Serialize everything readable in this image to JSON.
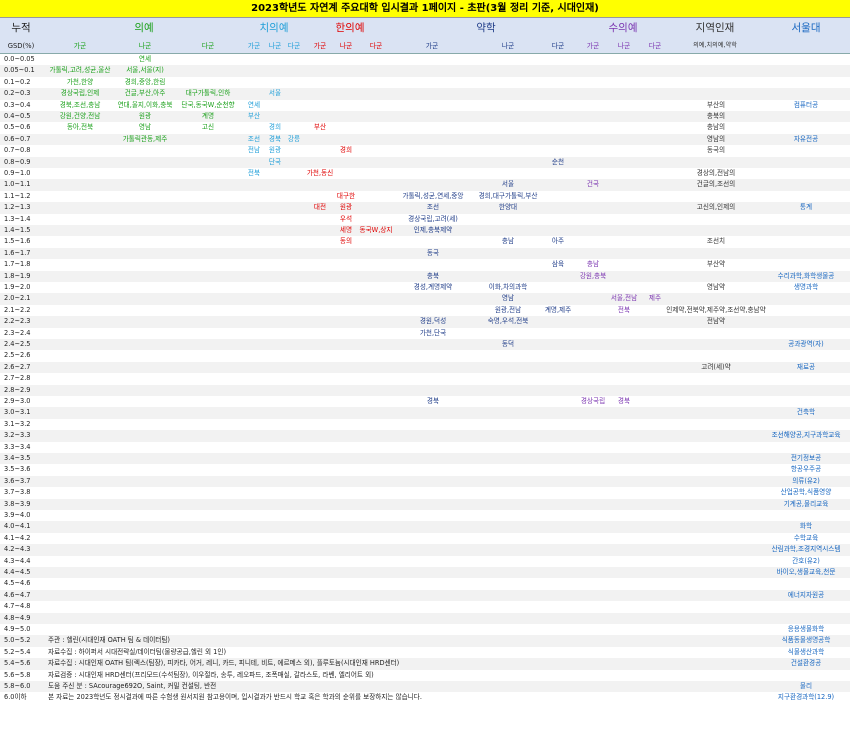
{
  "title": "2023학년도 자연계 주요대학 입시결과 1페이지 - 초판(3월 정리 기준, 시대인재)",
  "header": {
    "cumulative": "누적",
    "gsd": "GSD(%)",
    "groups": [
      {
        "label": "의예",
        "color": "#1aa01a"
      },
      {
        "label": "치의예",
        "color": "#1e9ed8"
      },
      {
        "label": "한의예",
        "color": "#e00000"
      },
      {
        "label": "약학",
        "color": "#1f3c88"
      },
      {
        "label": "수의예",
        "color": "#7a33b0"
      },
      {
        "label": "지역인재",
        "color": "#333333"
      },
      {
        "label": "서울대",
        "color": "#1565c0"
      }
    ],
    "subs": [
      "가군",
      "나군",
      "다군",
      "가군",
      "나군",
      "다군",
      "가군",
      "나군",
      "다군",
      "가군",
      "나군",
      "다군",
      "가군",
      "나군",
      "다군",
      "의예,치의예,약학",
      ""
    ]
  },
  "rows": [
    {
      "label": "0.0~0.05",
      "cells": [
        [
          "c1",
          "연세"
        ]
      ]
    },
    {
      "label": "0.05~0.1",
      "cells": [
        [
          "c0",
          "가톨릭,고려,성균,울산"
        ],
        [
          "c1",
          "서울,서울(지)"
        ]
      ]
    },
    {
      "label": "0.1~0.2",
      "cells": [
        [
          "c0",
          "가천,한양"
        ],
        [
          "c1",
          "경희,중앙,한림"
        ]
      ]
    },
    {
      "label": "0.2~0.3",
      "cells": [
        [
          "c0",
          "경상국립,인제"
        ],
        [
          "c1",
          "건글,부산,아주"
        ],
        [
          "c2",
          "대구가톨릭,인하"
        ],
        [
          "c4",
          "서울"
        ]
      ]
    },
    {
      "label": "0.3~0.4",
      "cells": [
        [
          "c0",
          "경북,조선,충남"
        ],
        [
          "c1",
          "연대,울지,이화,충북"
        ],
        [
          "c2",
          "단국,동국W,순천향"
        ],
        [
          "c3",
          "연세"
        ],
        [
          "c15",
          "부산의"
        ],
        [
          "c16",
          "컴퓨터공"
        ]
      ]
    },
    {
      "label": "0.4~0.5",
      "cells": [
        [
          "c0",
          "강원,건양,전남"
        ],
        [
          "c1",
          "원광"
        ],
        [
          "c2",
          "계명"
        ],
        [
          "c3",
          "부산"
        ],
        [
          "c15",
          "충북의"
        ]
      ]
    },
    {
      "label": "0.5~0.6",
      "cells": [
        [
          "c0",
          "동아,전북"
        ],
        [
          "c1",
          "영남"
        ],
        [
          "c2",
          "고신"
        ],
        [
          "c4",
          "경희"
        ],
        [
          "c6",
          "부산"
        ],
        [
          "c15",
          "충남의"
        ]
      ]
    },
    {
      "label": "0.6~0.7",
      "cells": [
        [
          "c1",
          "가톨릭관동,제주"
        ],
        [
          "c3",
          "조선"
        ],
        [
          "c4",
          "경북"
        ],
        [
          "c5",
          "강릉"
        ],
        [
          "c15",
          "영남의"
        ],
        [
          "c16",
          "자유전공"
        ]
      ]
    },
    {
      "label": "0.7~0.8",
      "cells": [
        [
          "c3",
          "전남"
        ],
        [
          "c4",
          "원광"
        ],
        [
          "c7",
          "경희"
        ],
        [
          "c15",
          "동국의"
        ]
      ]
    },
    {
      "label": "0.8~0.9",
      "cells": [
        [
          "c4",
          "단국"
        ],
        [
          "c11",
          "순천"
        ]
      ]
    },
    {
      "label": "0.9~1.0",
      "cells": [
        [
          "c3",
          "전북"
        ],
        [
          "c6",
          "가천,동신"
        ],
        [
          "c15",
          "경상의,전남의"
        ]
      ]
    },
    {
      "label": "1.0~1.1",
      "cells": [
        [
          "c10",
          "서울"
        ],
        [
          "c12",
          "건국"
        ],
        [
          "c15",
          "건글의,조선의"
        ]
      ]
    },
    {
      "label": "1.1~1.2",
      "cells": [
        [
          "c7",
          "대구한"
        ],
        [
          "c9",
          "가톨릭,성균,연세,중앙"
        ],
        [
          "c10",
          "경희,대구가톨릭,부산"
        ]
      ]
    },
    {
      "label": "1.2~1.3",
      "cells": [
        [
          "c6",
          "대전"
        ],
        [
          "c7",
          "원광"
        ],
        [
          "c9",
          "조선"
        ],
        [
          "c10",
          "한양대"
        ],
        [
          "c15",
          "고신의,인제의"
        ],
        [
          "c16",
          "통계"
        ]
      ]
    },
    {
      "label": "1.3~1.4",
      "cells": [
        [
          "c7",
          "우석"
        ],
        [
          "c9",
          "경상국립,고려(세)"
        ]
      ]
    },
    {
      "label": "1.4~1.5",
      "cells": [
        [
          "c7",
          "세명"
        ],
        [
          "c8",
          "동국W,상지"
        ],
        [
          "c9",
          "인제,충북제약"
        ]
      ]
    },
    {
      "label": "1.5~1.6",
      "cells": [
        [
          "c7",
          "동의"
        ],
        [
          "c10",
          "충남"
        ],
        [
          "c11",
          "아주"
        ],
        [
          "c15",
          "조선치"
        ]
      ]
    },
    {
      "label": "1.6~1.7",
      "cells": [
        [
          "c9",
          "동국"
        ]
      ]
    },
    {
      "label": "1.7~1.8",
      "cells": [
        [
          "c11",
          "삼육"
        ],
        [
          "c12",
          "충남"
        ],
        [
          "c15",
          "부산약"
        ]
      ]
    },
    {
      "label": "1.8~1.9",
      "cells": [
        [
          "c9",
          "충북"
        ],
        [
          "c12",
          "강원,충북"
        ],
        [
          "c16",
          "수리과학,화학생물공"
        ]
      ]
    },
    {
      "label": "1.9~2.0",
      "cells": [
        [
          "c9",
          "경성,계명제약"
        ],
        [
          "c10",
          "이화,차의과학"
        ],
        [
          "c15",
          "영남약"
        ],
        [
          "c16",
          "생명과학"
        ]
      ]
    },
    {
      "label": "2.0~2.1",
      "cells": [
        [
          "c10",
          "영남"
        ],
        [
          "c13",
          "서울,전남"
        ],
        [
          "c14",
          "제주"
        ]
      ]
    },
    {
      "label": "2.1~2.2",
      "cells": [
        [
          "c10",
          "원광,전남"
        ],
        [
          "c11",
          "계명,제주"
        ],
        [
          "c13",
          "전북"
        ],
        [
          "c15",
          "인제약,전북약,제주약,조선약,충남약"
        ]
      ]
    },
    {
      "label": "2.2~2.3",
      "cells": [
        [
          "c9",
          "경원,덕성"
        ],
        [
          "c10",
          "숙명,우석,전북"
        ],
        [
          "c15",
          "전남약"
        ]
      ]
    },
    {
      "label": "2.3~2.4",
      "cells": [
        [
          "c9",
          "가천,단국"
        ]
      ]
    },
    {
      "label": "2.4~2.5",
      "cells": [
        [
          "c10",
          "동덕"
        ],
        [
          "c16",
          "공과광역(자)"
        ]
      ]
    },
    {
      "label": "2.5~2.6",
      "cells": []
    },
    {
      "label": "2.6~2.7",
      "cells": [
        [
          "c15",
          "고려(세)약"
        ],
        [
          "c16",
          "재료공"
        ]
      ]
    },
    {
      "label": "2.7~2.8",
      "cells": []
    },
    {
      "label": "2.8~2.9",
      "cells": []
    },
    {
      "label": "2.9~3.0",
      "cells": [
        [
          "c9",
          "경북"
        ],
        [
          "c12",
          "경상국립"
        ],
        [
          "c13",
          "경북"
        ]
      ]
    },
    {
      "label": "3.0~3.1",
      "cells": [
        [
          "c16",
          "건축학"
        ]
      ]
    },
    {
      "label": "3.1~3.2",
      "cells": []
    },
    {
      "label": "3.2~3.3",
      "cells": [
        [
          "c16",
          "조선해양공,지구과학교육"
        ]
      ]
    },
    {
      "label": "3.3~3.4",
      "cells": []
    },
    {
      "label": "3.4~3.5",
      "cells": [
        [
          "c16",
          "전기정보공"
        ]
      ]
    },
    {
      "label": "3.5~3.6",
      "cells": [
        [
          "c16",
          "항공우주공"
        ]
      ]
    },
    {
      "label": "3.6~3.7",
      "cells": [
        [
          "c16",
          "의류(유2)"
        ]
      ]
    },
    {
      "label": "3.7~3.8",
      "cells": [
        [
          "c16",
          "산업공학,식품영양"
        ]
      ]
    },
    {
      "label": "3.8~3.9",
      "cells": [
        [
          "c16",
          "기계공,물리교육"
        ]
      ]
    },
    {
      "label": "3.9~4.0",
      "cells": []
    },
    {
      "label": "4.0~4.1",
      "cells": [
        [
          "c16",
          "화학"
        ]
      ]
    },
    {
      "label": "4.1~4.2",
      "cells": [
        [
          "c16",
          "수학교육"
        ]
      ]
    },
    {
      "label": "4.2~4.3",
      "cells": [
        [
          "c16",
          "산림과학,조경지역시스템"
        ]
      ]
    },
    {
      "label": "4.3~4.4",
      "cells": [
        [
          "c16",
          "간호(유2)"
        ]
      ]
    },
    {
      "label": "4.4~4.5",
      "cells": [
        [
          "c16",
          "바이오,생물교육,천문"
        ]
      ]
    },
    {
      "label": "4.5~4.6",
      "cells": []
    },
    {
      "label": "4.6~4.7",
      "cells": [
        [
          "c16",
          "에너지자원공"
        ]
      ]
    },
    {
      "label": "4.7~4.8",
      "cells": []
    },
    {
      "label": "4.8~4.9",
      "cells": []
    },
    {
      "label": "4.9~5.0",
      "cells": [
        [
          "c16",
          "응용생물화학"
        ]
      ]
    },
    {
      "label": "5.0~5.2",
      "cells": [
        [
          "c16",
          "식품동물생명공학"
        ]
      ]
    },
    {
      "label": "5.2~5.4",
      "cells": [
        [
          "c16",
          "식물생산과학"
        ]
      ]
    },
    {
      "label": "5.4~5.6",
      "cells": [
        [
          "c16",
          "건설환경공"
        ]
      ]
    },
    {
      "label": "5.6~5.8",
      "cells": []
    },
    {
      "label": "5.8~6.0",
      "cells": [
        [
          "c16",
          "물리"
        ]
      ]
    },
    {
      "label": "6.0이하",
      "cells": [
        [
          "c16",
          "지구환경과학(12.9)"
        ]
      ]
    }
  ],
  "notes": [
    "주관 : 헬린(시대인재 OATH 팀 & 데이터팀)",
    "자료수집 : 하이퍼서 시대전략실/데이터팀(물량공급,헬린 외 1인)",
    "자료수집 : 시대인재 OATH 팀(렉스(팀장), 피카타, 어거, 레니, 카드, 피니테, 비트, 에르메스 외), 플루토늄(시대인재 HRD센터)",
    "자료검증 : 시대인재 HRD센터(프리모드(수석팀장), 이우절라, 송투, 레오파드, 조폭매실, 갈라스토, 라벤, 엘리어트 외)",
    "도움 주신 분 : SAcourage692O, Saint, 커밀 컨설팅, 반전",
    "본 자료는 2023학년도 정시결과에 따른 수험생 원서지원 참고용이며, 입시결과가 반드시 학교 혹은 학과의 순위를 보장하지는 않습니다."
  ]
}
